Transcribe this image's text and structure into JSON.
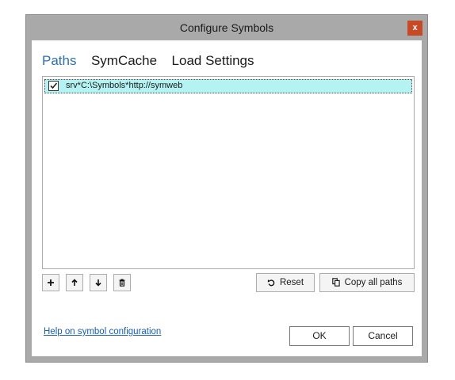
{
  "window": {
    "title": "Configure Symbols",
    "close_label": "x"
  },
  "tabs": [
    {
      "label": "Paths",
      "active": true
    },
    {
      "label": "SymCache",
      "active": false
    },
    {
      "label": "Load Settings",
      "active": false
    }
  ],
  "paths": [
    {
      "checked": true,
      "value": "srv*C:\\Symbols*http://symweb"
    }
  ],
  "toolbar": {
    "add_icon": "plus-icon",
    "up_icon": "arrow-up-icon",
    "down_icon": "arrow-down-icon",
    "delete_icon": "trash-icon",
    "reset_label": "Reset",
    "copy_label": "Copy all paths"
  },
  "footer": {
    "help_link": "Help on symbol configuration",
    "ok_label": "OK",
    "cancel_label": "Cancel"
  },
  "colors": {
    "titlebar": "#a9a9a9",
    "close": "#c74a25",
    "active_tab": "#2d6fb5",
    "selected_row": "#b5f3f3",
    "link": "#1a5fb4"
  }
}
